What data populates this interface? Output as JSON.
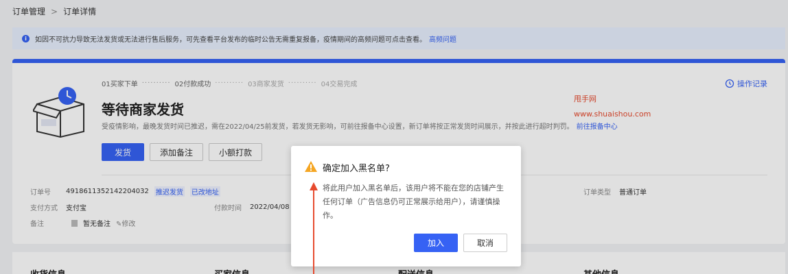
{
  "breadcrumb": {
    "parent": "订单管理",
    "current": "订单详情"
  },
  "notice": {
    "text": "如因不可抗力导致无法发货或无法进行售后服务，可先查看平台发布的临时公告无需重复报备，疫情期间的高频问题可点击查看。",
    "link": "高频问题"
  },
  "steps": {
    "s1": "01买家下单",
    "s2": "02付款成功",
    "s3": "03商家发货",
    "s4": "04交易完成"
  },
  "status": {
    "title": "等待商家发货",
    "subtext": "受疫情影响，最晚发货时间已推迟，需在2022/04/25前发货，若发货无影响，可前往报备中心设置，新订单将按正常发货时间展示，并按此进行超时判罚。",
    "sublink": "前往报备中心"
  },
  "actions": {
    "ship": "发货",
    "add_note": "添加备注",
    "small_pay": "小额打款"
  },
  "oprecord": "操作记录",
  "watermark": {
    "line1": "甩手网",
    "line2": "www.shuaishou.com"
  },
  "info": {
    "order_no_label": "订单号",
    "order_no": "4918611352142204032",
    "delay_ship": "推迟发货",
    "addr_changed": "已改地址",
    "pay_method_label": "支付方式",
    "pay_method": "支付宝",
    "pay_time_label": "付款时间",
    "pay_time": "2022/04/08 1",
    "order_type_label": "订单类型",
    "order_type": "普通订单",
    "note_label": "备注",
    "note": "暂无备注",
    "edit": "修改"
  },
  "bottom": {
    "h1": "收货信息",
    "h2": "买家信息",
    "h3": "配送信息",
    "h4": "其他信息"
  },
  "dialog": {
    "title": "确定加入黑名单?",
    "body": "将此用户加入黑名单后，该用户将不能在您的店铺产生任何订单（广告信息仍可正常展示给用户），请谨慎操作。",
    "confirm": "加入",
    "cancel": "取消"
  },
  "colors": {
    "accent": "#3662f4",
    "warning": "#f5a623",
    "annotation": "#e64a2e"
  }
}
